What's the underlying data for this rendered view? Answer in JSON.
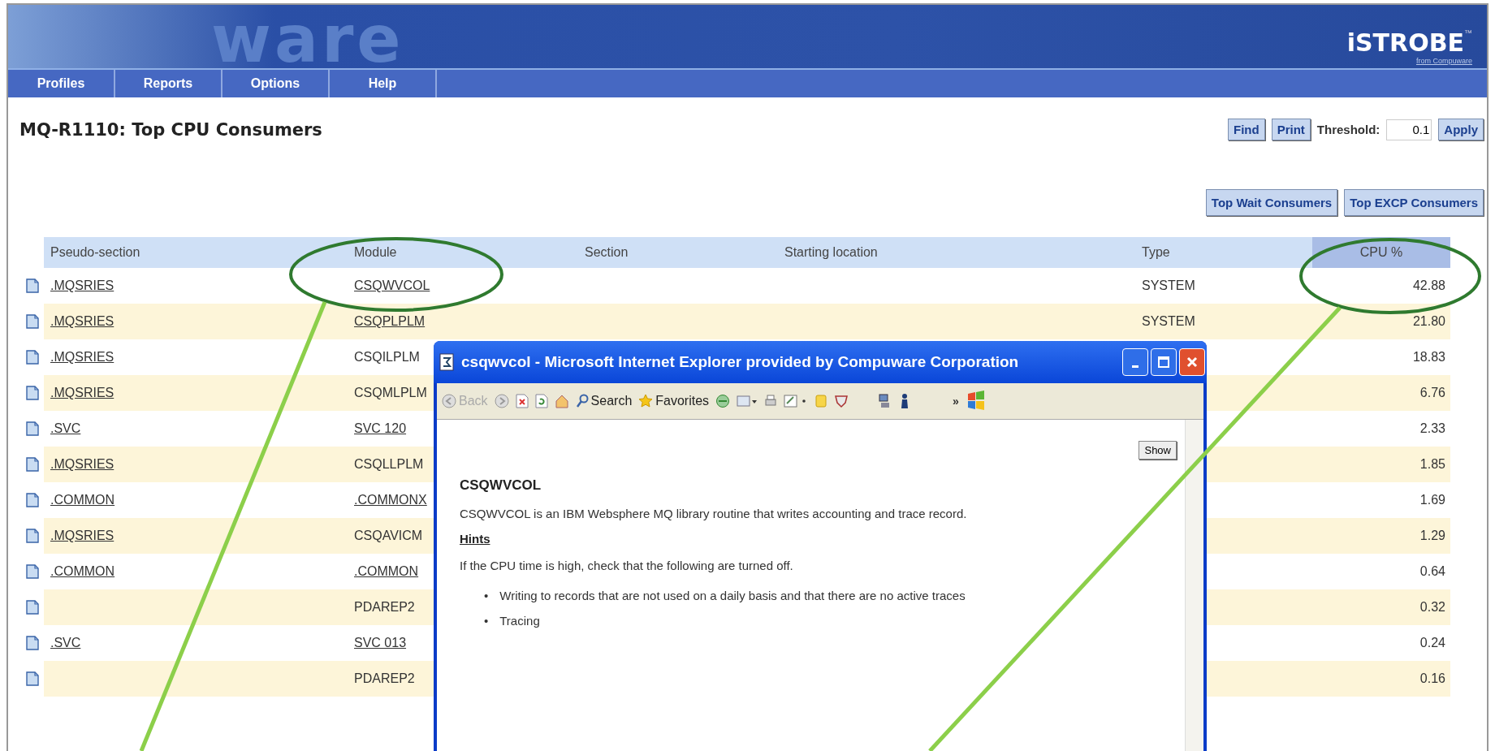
{
  "banner": {
    "logo_text": "ware",
    "brand": "iSTROBE",
    "trademark": "™",
    "brand_sub": "from Compuware"
  },
  "menu": [
    "Profiles",
    "Reports",
    "Options",
    "Help"
  ],
  "page_title": "MQ-R1110: Top CPU Consumers",
  "toolbar": {
    "buttons": [
      "Find",
      "Print"
    ],
    "threshold_label": "Threshold:",
    "threshold_value": "0.1",
    "apply": "Apply"
  },
  "report_buttons": [
    "Top Wait Consumers",
    "Top EXCP Consumers"
  ],
  "table": {
    "columns": [
      "Pseudo-section",
      "Module",
      "Section",
      "Starting location",
      "Type",
      "CPU %"
    ],
    "rows": [
      {
        "pseudo_section": ".MQSRIES",
        "module": "CSQWVCOL",
        "module_link": true,
        "type": "SYSTEM",
        "cpu": "42.88"
      },
      {
        "pseudo_section": ".MQSRIES",
        "module": "CSQPLPLM",
        "module_link": true,
        "type": "SYSTEM",
        "cpu": "21.80"
      },
      {
        "pseudo_section": ".MQSRIES",
        "module": "CSQILPLM",
        "module_link": false,
        "cpu": "18.83"
      },
      {
        "pseudo_section": ".MQSRIES",
        "module": "CSQMLPLM",
        "module_link": false,
        "cpu": "6.76"
      },
      {
        "pseudo_section": ".SVC",
        "module": "SVC 120",
        "module_link": true,
        "cpu": "2.33"
      },
      {
        "pseudo_section": ".MQSRIES",
        "module": "CSQLLPLM",
        "module_link": false,
        "cpu": "1.85"
      },
      {
        "pseudo_section": ".COMMON",
        "module": ".COMMONX",
        "module_link": true,
        "cpu": "1.69"
      },
      {
        "pseudo_section": ".MQSRIES",
        "module": "CSQAVICM",
        "module_link": false,
        "cpu": "1.29"
      },
      {
        "pseudo_section": ".COMMON",
        "module": ".COMMON",
        "module_link": true,
        "cpu": "0.64"
      },
      {
        "module": "PDAREP2",
        "module_link": false,
        "cpu": "0.32"
      },
      {
        "pseudo_section": ".SVC",
        "module": "SVC 013",
        "module_link": true,
        "cpu": "0.24"
      },
      {
        "module": "PDAREP2",
        "module_link": false,
        "cpu": "0.16"
      }
    ]
  },
  "popup": {
    "title": "csqwvcol - Microsoft Internet Explorer provided by Compuware Corporation",
    "toolbar": {
      "back": "Back",
      "search": "Search",
      "favorites": "Favorites",
      "chevron": "»"
    },
    "show_button": "Show",
    "heading": "CSQWVCOL",
    "description": "CSQWVCOL is an IBM Websphere MQ library routine that writes accounting and trace record.",
    "hints_label": "Hints",
    "hints_intro": "If the CPU time is high, check that the following are turned off.",
    "bullet_marker": "•",
    "bullets": [
      "Writing to records that are not used on a daily basis and that there are no active traces",
      "Tracing"
    ]
  }
}
